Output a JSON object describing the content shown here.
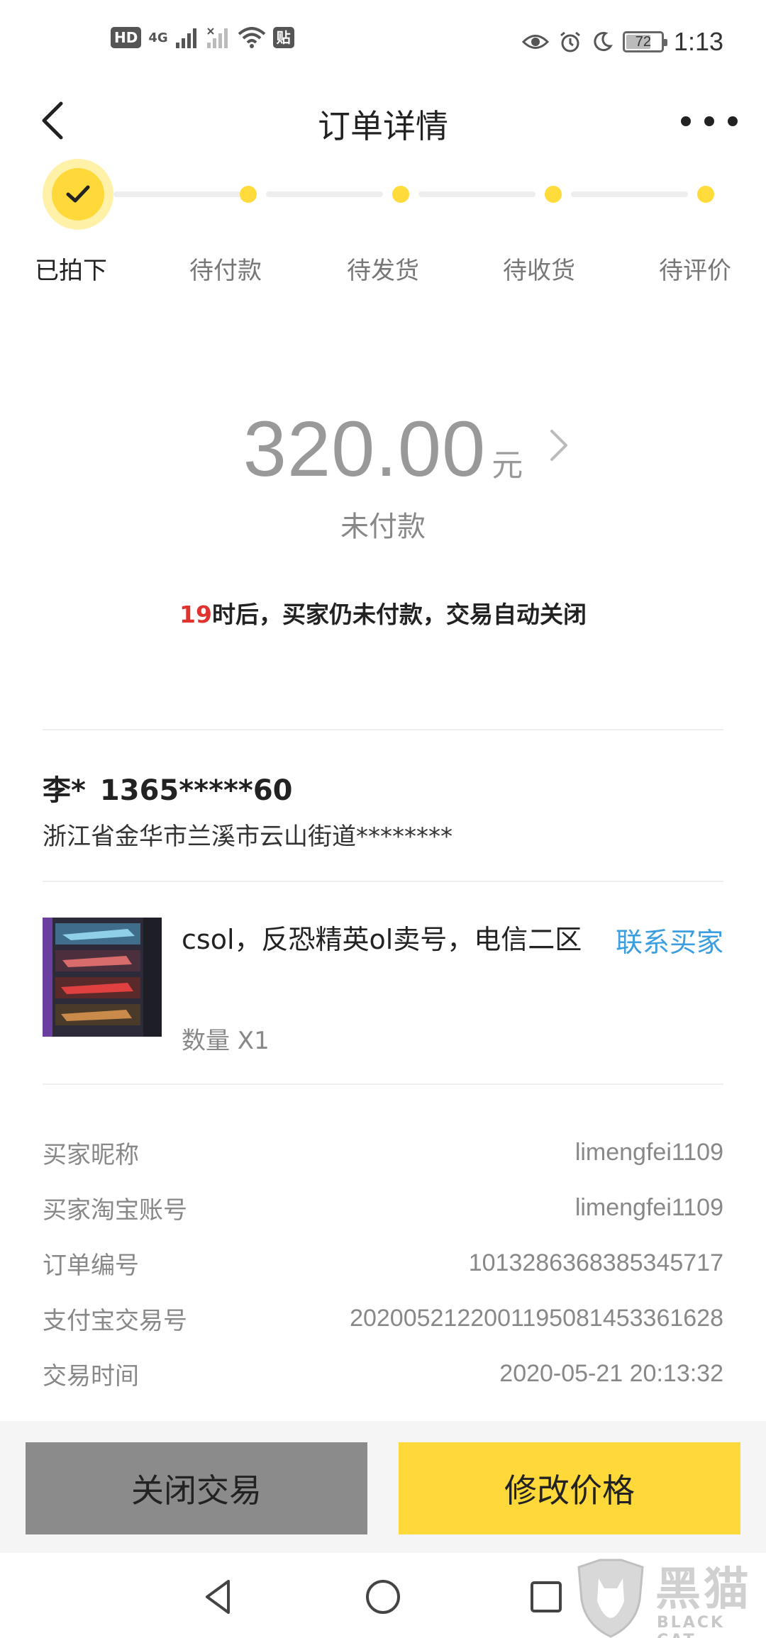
{
  "status_bar": {
    "hd_badge": "HD",
    "network": "4G",
    "app_badge": "贴",
    "battery": "72",
    "battery_level": 0.72,
    "time": "1:13"
  },
  "header": {
    "title": "订单详情"
  },
  "steps": {
    "labels": [
      "已拍下",
      "待付款",
      "待发货",
      "待收货",
      "待评价"
    ],
    "current_index": 0
  },
  "order_summary": {
    "amount": "320.00",
    "currency": "元",
    "status": "未付款",
    "notice_hours": "19",
    "notice_text": "时后，买家仍未付款，交易自动关闭"
  },
  "address": {
    "name": "李*",
    "phone": "1365*****60",
    "detail": "浙江省金华市兰溪市云山街道********"
  },
  "product": {
    "title": "csol，反恐精英ol卖号，电信二区",
    "quantity": "数量 X1",
    "contact_label": "联系买家"
  },
  "info": [
    {
      "label": "买家昵称",
      "value": "limengfei1109"
    },
    {
      "label": "买家淘宝账号",
      "value": "limengfei1109"
    },
    {
      "label": "订单编号",
      "value": "1013286368385345717"
    },
    {
      "label": "支付宝交易号",
      "value": "2020052122001195081453361628"
    },
    {
      "label": "交易时间",
      "value": "2020-05-21 20:13:32"
    }
  ],
  "actions": {
    "close_label": "关闭交易",
    "modify_label": "修改价格"
  },
  "watermark": {
    "cn": "黑猫",
    "en": "BLACK CAT"
  },
  "colors": {
    "accent": "#ffd93a",
    "link": "#3a9ee0",
    "highlight": "#e0322f",
    "close_button": "#8b8b8b"
  }
}
